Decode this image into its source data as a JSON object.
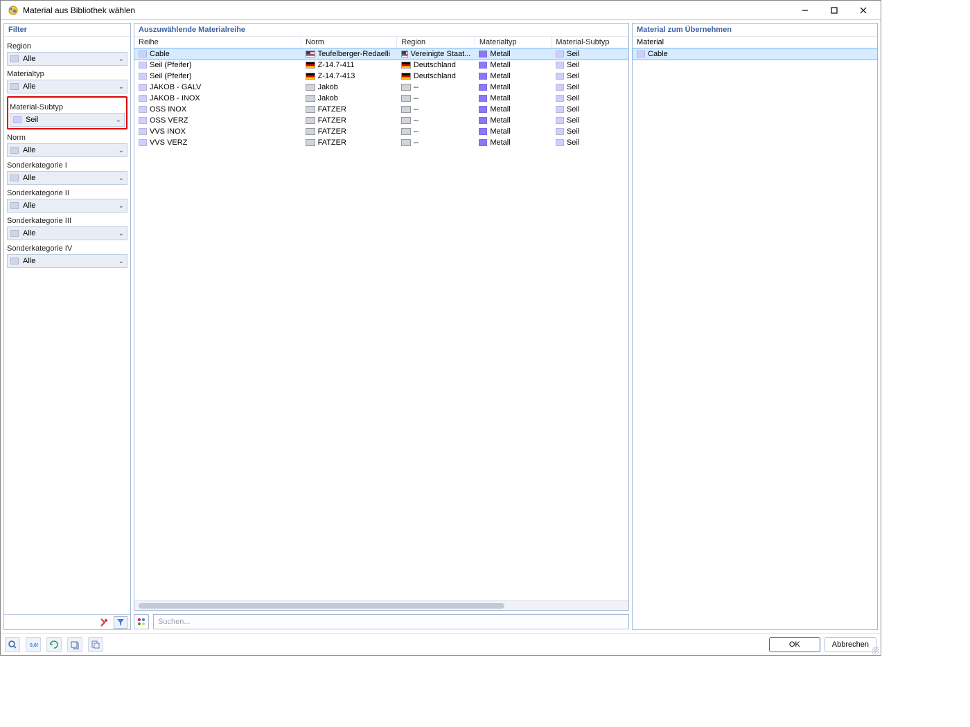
{
  "window": {
    "title": "Material aus Bibliothek wählen"
  },
  "sidebar": {
    "header": "Filter",
    "filters": [
      {
        "label": "Region",
        "value": "Alle",
        "chip": "plain"
      },
      {
        "label": "Materialtyp",
        "value": "Alle",
        "chip": "plain"
      },
      {
        "label": "Material-Subtyp",
        "value": "Seil",
        "chip": "seil",
        "highlight": true
      },
      {
        "label": "Norm",
        "value": "Alle",
        "chip": "plain"
      },
      {
        "label": "Sonderkategorie I",
        "value": "Alle",
        "chip": "plain"
      },
      {
        "label": "Sonderkategorie II",
        "value": "Alle",
        "chip": "plain"
      },
      {
        "label": "Sonderkategorie III",
        "value": "Alle",
        "chip": "plain"
      },
      {
        "label": "Sonderkategorie IV",
        "value": "Alle",
        "chip": "plain"
      }
    ]
  },
  "center": {
    "header": "Auszuwählende Materialreihe",
    "columns": [
      "Reihe",
      "Norm",
      "Region",
      "Materialtyp",
      "Material-Subtyp"
    ],
    "rows": [
      {
        "reihe": "Cable",
        "norm": "Teufelberger-Redaelli",
        "flag": "us",
        "region": "Vereinigte Staat...",
        "typ": "Metall",
        "sub": "Seil",
        "selected": true
      },
      {
        "reihe": "Seil (Pfeifer)",
        "norm": "Z-14.7-411",
        "flag": "de",
        "region": "Deutschland",
        "typ": "Metall",
        "sub": "Seil"
      },
      {
        "reihe": "Seil (Pfeifer)",
        "norm": "Z-14.7-413",
        "flag": "de",
        "region": "Deutschland",
        "typ": "Metall",
        "sub": "Seil"
      },
      {
        "reihe": "JAKOB - GALV",
        "norm": "Jakob",
        "flag": "none",
        "region": "--",
        "typ": "Metall",
        "sub": "Seil"
      },
      {
        "reihe": "JAKOB - INOX",
        "norm": "Jakob",
        "flag": "none",
        "region": "--",
        "typ": "Metall",
        "sub": "Seil"
      },
      {
        "reihe": "OSS INOX",
        "norm": "FATZER",
        "flag": "none",
        "region": "--",
        "typ": "Metall",
        "sub": "Seil"
      },
      {
        "reihe": "OSS VERZ",
        "norm": "FATZER",
        "flag": "none",
        "region": "--",
        "typ": "Metall",
        "sub": "Seil"
      },
      {
        "reihe": "VVS INOX",
        "norm": "FATZER",
        "flag": "none",
        "region": "--",
        "typ": "Metall",
        "sub": "Seil"
      },
      {
        "reihe": "VVS VERZ",
        "norm": "FATZER",
        "flag": "none",
        "region": "--",
        "typ": "Metall",
        "sub": "Seil"
      }
    ],
    "search_placeholder": "Suchen..."
  },
  "right": {
    "header": "Material zum Übernehmen",
    "column": "Material",
    "rows": [
      {
        "label": "Cable",
        "selected": true
      }
    ]
  },
  "footer": {
    "ok": "OK",
    "cancel": "Abbrechen"
  }
}
